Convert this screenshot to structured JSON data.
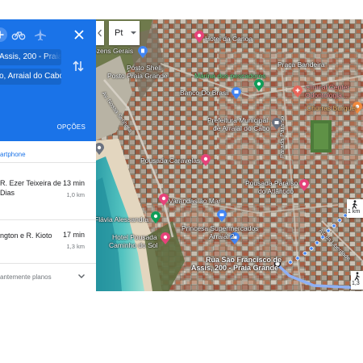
{
  "colors": {
    "accent": "#1a73e8",
    "route_dots": "#4285f4",
    "pin_pink": "#e6427a",
    "pin_blue": "#4285f4",
    "pin_green": "#0f9d58",
    "pin_orange": "#f0893e",
    "pin_gray": "#6b7280"
  },
  "directions": {
    "travel_modes": [
      "car-icon",
      "bicycle-icon",
      "flight-icon"
    ],
    "origin": "Assis, 200 - Praia G",
    "destination": "o, Arraial do Cabo",
    "options_label": "OPÇÕES",
    "send_to_phone": "artphone",
    "routes": [
      {
        "name": "R. Ezer Teixeira de\nDias",
        "time": "13 min",
        "distance": "1,0 km"
      },
      {
        "name": "ngton e R. Kioto",
        "time": "17 min",
        "distance": "1,3 km"
      }
    ],
    "more_plans": "antemente planos"
  },
  "map": {
    "layer_button": "Pt",
    "walking_duration": "1 km",
    "walking_duration_2": "1,3",
    "labels": {
      "hotel_da_canoa": "Hotel da Canoa",
      "posto_shell": "Posto Shell",
      "posto_shell_2": "Posto Praia Grande",
      "zens_gerais": "ozens Gerais",
      "praca_bandeira": "Praça Bandeira",
      "marina": "Marina dos pescadores",
      "banco": "Banco Do Brasil",
      "clinica": "Clinical Center",
      "clinica_2": "Odontologia...",
      "churras": "Churras Burguer",
      "prefeitura": "Prefeitura Municipal",
      "prefeitura_2": "de Arraial do Cabo",
      "pousada_caravelas": "Pousada Caravelas",
      "parada": "Parada Paraíso",
      "pousada_paraiso": "Pousada Paraíso",
      "pousada_paraiso_2": "do Atlântico",
      "varandas": "Varandas ao Mar",
      "flavia": "Flávia Alessandra",
      "hotel_pousada": "Hotel Pousada",
      "hotel_pousada_2": "Caminho do Sol",
      "princesa": "Princesa Supermercados",
      "princesa_2": "Arraial 2",
      "destination_1": "Rua São Francisco de",
      "destination_2": "Assis, 200 - Praia Grande",
      "road_vertical": "Av. Nossa Senhora",
      "road_bottom": "Av. da Liberdade"
    }
  }
}
